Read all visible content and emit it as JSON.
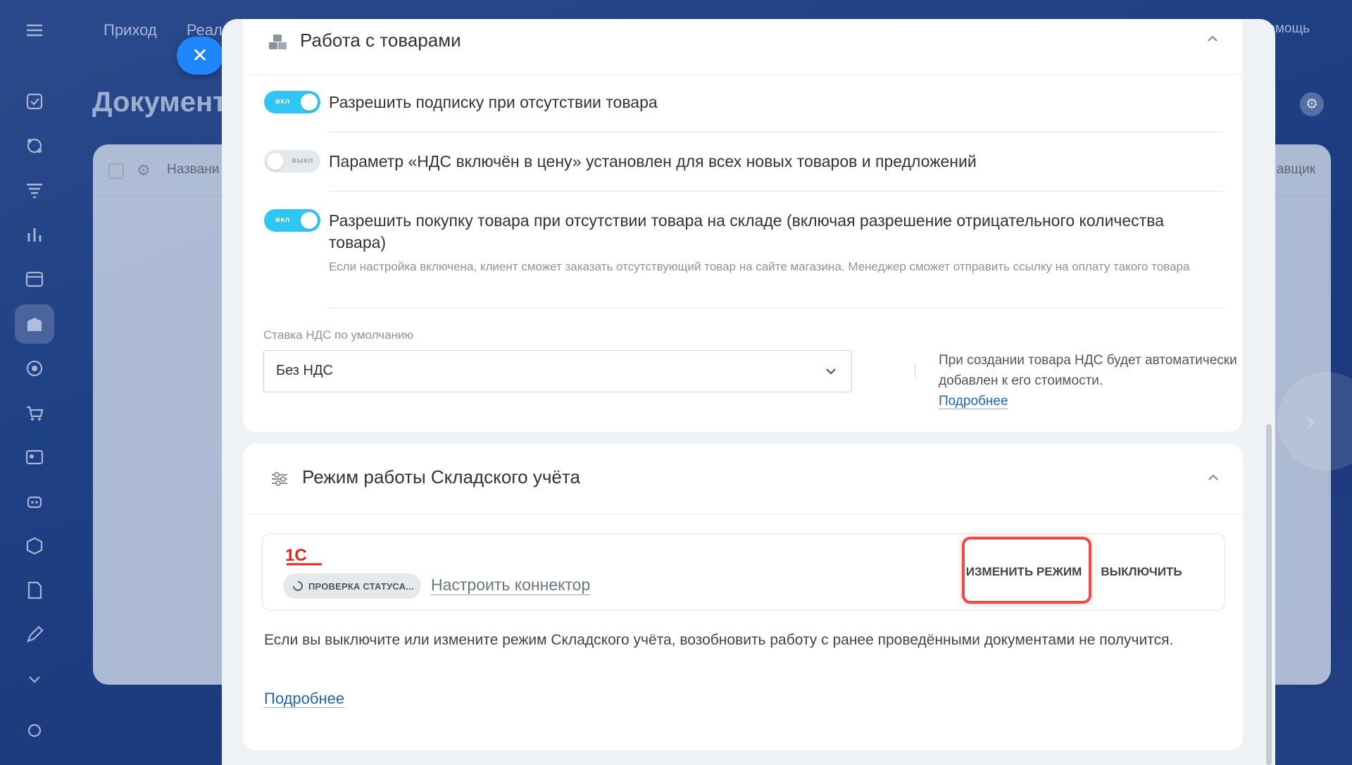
{
  "background": {
    "nav": [
      "Приход",
      "Реал"
    ],
    "help": "омощь",
    "page_title": "Документ",
    "table_col_name": "Названи",
    "table_col_last": "авщик"
  },
  "section_goods": {
    "title": "Работа с товарами",
    "options": [
      {
        "label": "Разрешить подписку при отсутствии товара",
        "state": "вкл",
        "on": true
      },
      {
        "label": "Параметр «НДС включён в цену» установлен для всех новых товаров и предложений",
        "state": "выкл",
        "on": false
      },
      {
        "label": "Разрешить покупку товара при отсутствии товара на складе (включая разрешение отрицательного количества товара)",
        "state": "вкл",
        "on": true,
        "hint": "Если настройка включена, клиент сможет заказать отсутствующий товар на сайте магазина. Менеджер сможет отправить ссылку на оплату такого товара"
      }
    ],
    "vat_label": "Ставка НДС по умолчанию",
    "vat_value": "Без НДС",
    "vat_note": "При создании товара НДС будет автоматически добавлен к его стоимости.",
    "vat_more": "Подробнее"
  },
  "section_mode": {
    "title": "Режим работы Складского учёта",
    "logo_text": "1С",
    "status": "ПРОВЕРКА СТАТУСА...",
    "connector_link": "Настроить коннектор",
    "change_button": "ИЗМЕНИТЬ РЕЖИМ",
    "off_button": "ВЫКЛЮЧИТЬ",
    "warning": "Если вы выключите или измените режим Складского учёта, возобновить работу с ранее проведёнными документами не получится.",
    "more": "Подробнее"
  },
  "colors": {
    "accent": "#2fc6f6",
    "close": "#1f86ff",
    "highlight": "#e84c4c",
    "link": "#2066b0",
    "logo": "#e1251b"
  }
}
